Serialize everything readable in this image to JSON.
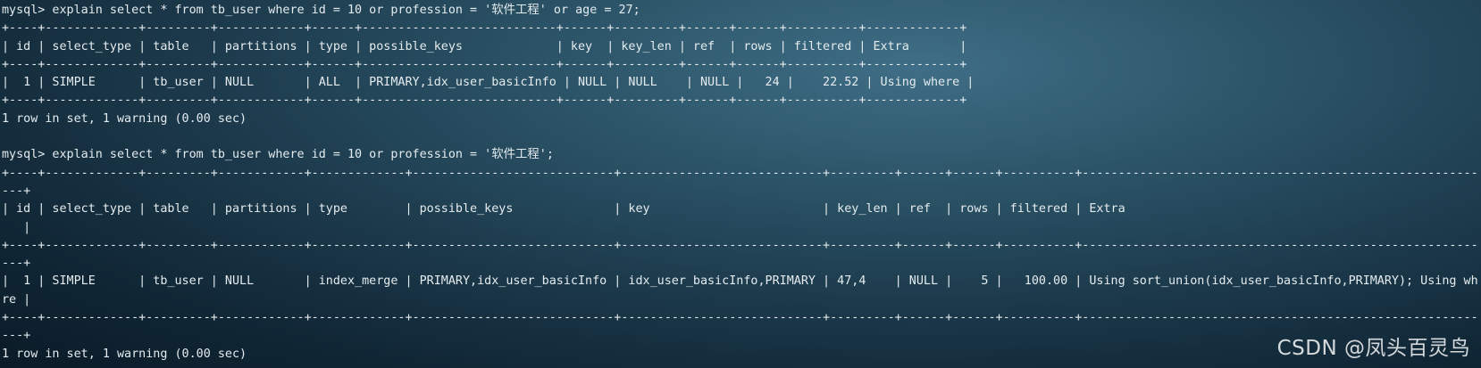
{
  "terminal": {
    "lines": [
      "mysql> explain select * from tb_user where id = 10 or profession = '软件工程' or age = 27;",
      "+----+-------------+---------+------------+------+---------------------------+------+---------+------+------+----------+-------------+",
      "| id | select_type | table   | partitions | type | possible_keys             | key  | key_len | ref  | rows | filtered | Extra       |",
      "+----+-------------+---------+------------+------+---------------------------+------+---------+------+------+----------+-------------+",
      "|  1 | SIMPLE      | tb_user | NULL       | ALL  | PRIMARY,idx_user_basicInfo | NULL | NULL    | NULL |   24 |    22.52 | Using where |",
      "+----+-------------+---------+------------+------+---------------------------+------+---------+------+------+----------+-------------+",
      "1 row in set, 1 warning (0.00 sec)",
      "",
      "mysql> explain select * from tb_user where id = 10 or profession = '软件工程';",
      "+----+-------------+---------+------------+-------------+----------------------------+----------------------------+---------+------+------+----------+----------------------------------------------------------------------------------+",
      "---+",
      "| id | select_type | table   | partitions | type        | possible_keys              | key                        | key_len | ref  | rows | filtered | Extra",
      "   |",
      "+----+-------------+---------+------------+-------------+----------------------------+----------------------------+---------+------+------+----------+----------------------------------------------------------------------------------+",
      "---+",
      "|  1 | SIMPLE      | tb_user | NULL       | index_merge | PRIMARY,idx_user_basicInfo | idx_user_basicInfo,PRIMARY | 47,4    | NULL |    5 |   100.00 | Using sort_union(idx_user_basicInfo,PRIMARY); Using whe",
      "re |",
      "+----+-------------+---------+------------+-------------+----------------------------+----------------------------+---------+------+------+----------+----------------------------------------------------------------------------------+",
      "---+",
      "1 row in set, 1 warning (0.00 sec)"
    ]
  },
  "watermark": {
    "text": "CSDN @凤头百灵鸟"
  }
}
